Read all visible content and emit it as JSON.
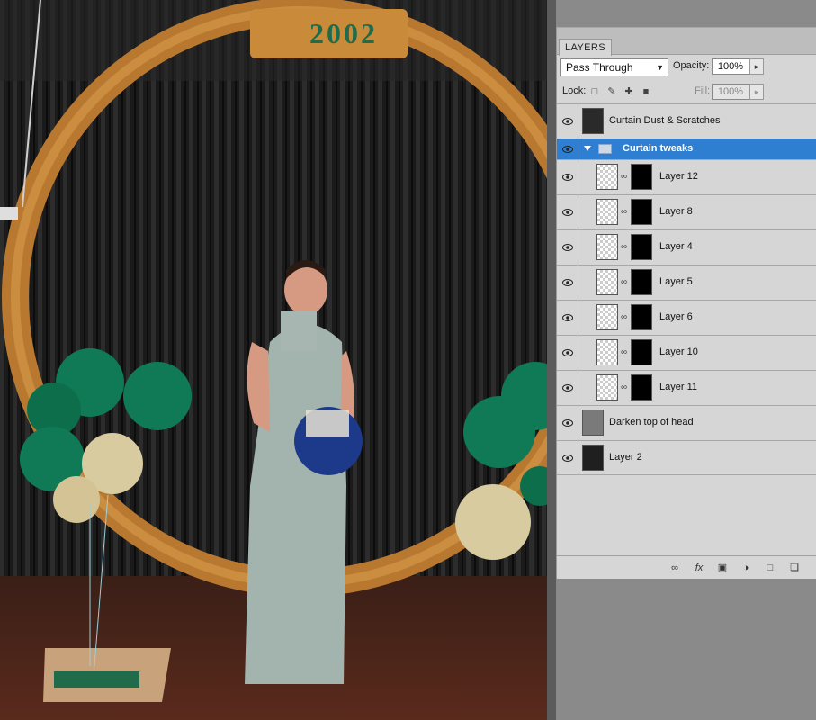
{
  "photo": {
    "arch_text": "2002",
    "colors": {
      "arch": "#c88a3a",
      "balloon_green": "#0f7a55",
      "balloon_gold": "#d9cba0",
      "dress": "#a3b3ad",
      "curtain": "#1d1d1d"
    }
  },
  "panel": {
    "tab_label": "LAYERS",
    "blend_mode": "Pass Through",
    "opacity_label": "Opacity:",
    "opacity_value": "100%",
    "lock_label": "Lock:",
    "fill_label": "Fill:",
    "fill_value": "100%",
    "layers": [
      {
        "name": "Curtain  Dust & Scratches",
        "kind": "image"
      },
      {
        "name": "Curtain tweaks",
        "kind": "group",
        "selected": true
      },
      {
        "name": "Layer 12",
        "kind": "masked"
      },
      {
        "name": "Layer 8",
        "kind": "masked"
      },
      {
        "name": "Layer 4",
        "kind": "masked"
      },
      {
        "name": "Layer 5",
        "kind": "masked"
      },
      {
        "name": "Layer 6",
        "kind": "masked"
      },
      {
        "name": "Layer 10",
        "kind": "masked"
      },
      {
        "name": "Layer 11",
        "kind": "masked"
      },
      {
        "name": "Darken top of head",
        "kind": "fill"
      },
      {
        "name": "Layer 2",
        "kind": "image"
      }
    ],
    "bottom_icons": [
      "link-icon",
      "fx-icon",
      "mask-icon",
      "adjustment-icon",
      "new-group-icon",
      "new-layer-icon"
    ],
    "accent_color": "#2e7fd1"
  }
}
